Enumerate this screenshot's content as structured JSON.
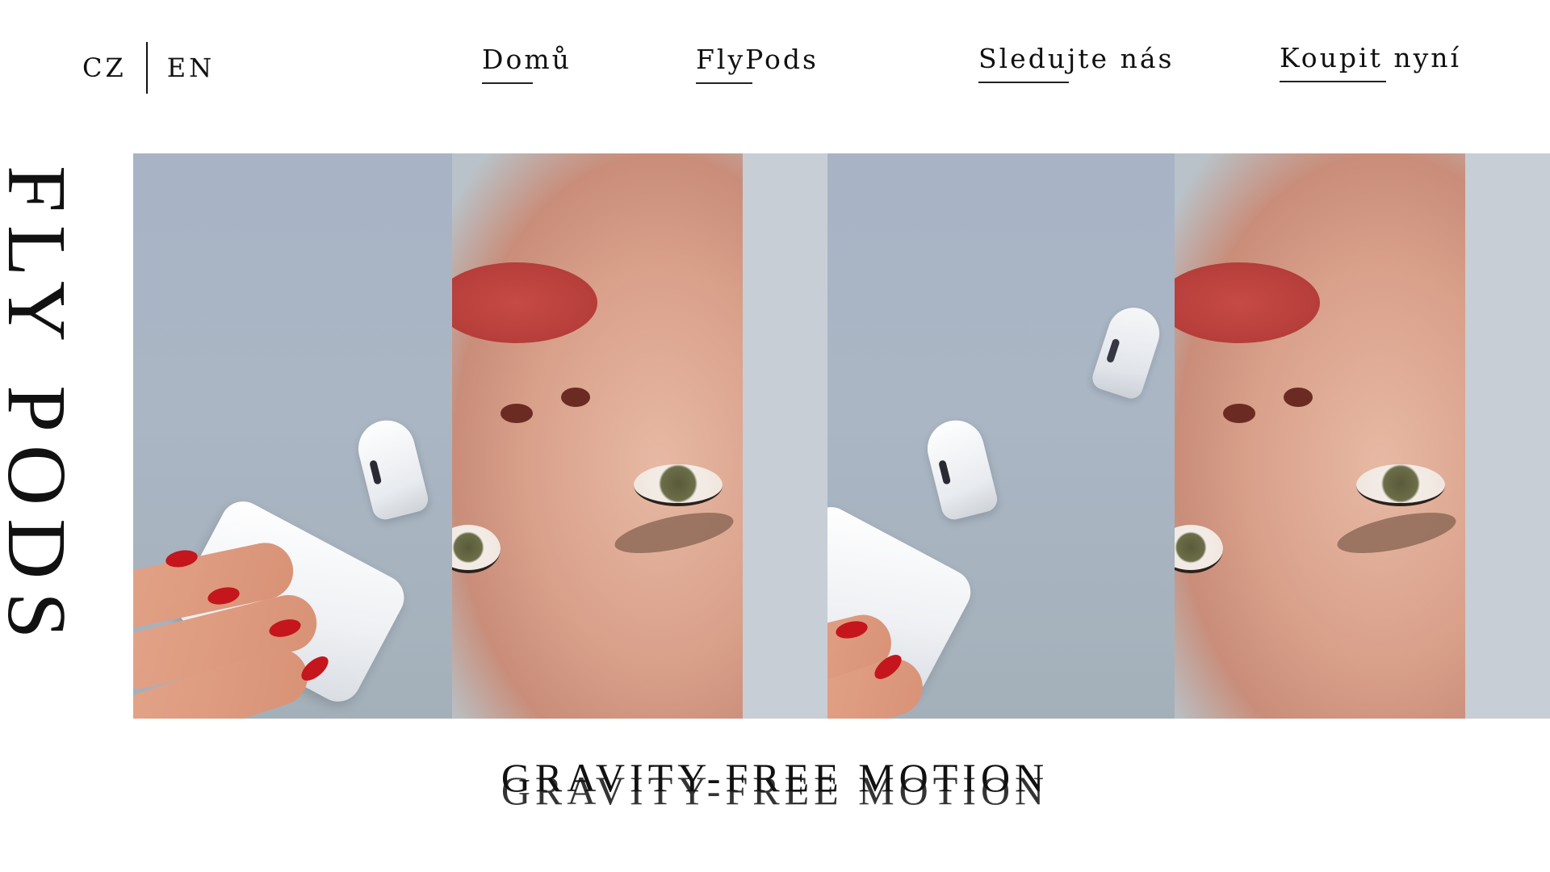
{
  "language_switch": {
    "cz": "CZ",
    "en": "EN"
  },
  "nav": {
    "home": "Domů",
    "flypods": "FlyPods",
    "follow": "Sledujte nás",
    "buy": "Koupit nyní"
  },
  "vertical_title": "FLY PODS",
  "tagline": "GRAVITY-FREE MOTION",
  "colors": {
    "text": "#111111",
    "background": "#ffffff",
    "nail_red": "#c4161c"
  }
}
